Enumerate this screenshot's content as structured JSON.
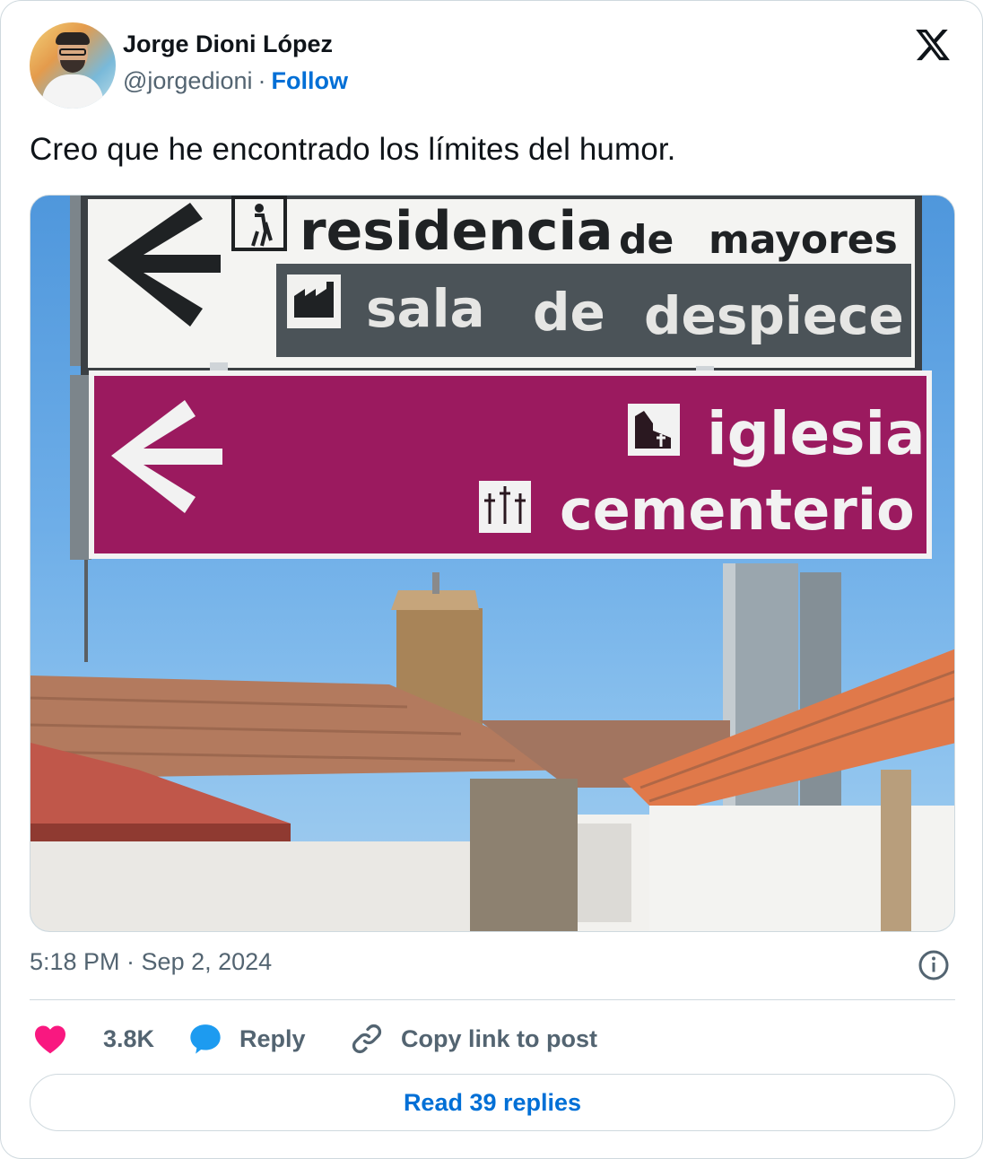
{
  "author": {
    "name": "Jorge Dioni López",
    "handle": "@jorgedioni",
    "separator": "·",
    "follow_label": "Follow"
  },
  "brand": {
    "logo_icon": "x-logo-icon"
  },
  "tweet": {
    "text": "Creo que he encontrado los límites del humor.",
    "timestamp": "5:18 PM · Sep 2, 2024"
  },
  "media": {
    "signs": [
      {
        "label": "residencia de mayores",
        "icon": "person-walking-cane-icon",
        "color": "#ffffff"
      },
      {
        "label": "sala de despiece",
        "icon": "factory-icon",
        "color": "#4b5358"
      },
      {
        "label": "iglesia",
        "icon": "church-icon",
        "color": "#9b1a5f"
      },
      {
        "label": "cementerio",
        "icon": "crosses-icon",
        "color": "#9b1a5f"
      }
    ],
    "words": {
      "residencia": "residencia",
      "de1": "de",
      "mayores": "mayores",
      "sala": "sala",
      "de2": "de",
      "despiece": "despiece",
      "iglesia": "iglesia",
      "cementerio": "cementerio"
    }
  },
  "actions": {
    "like_count": "3.8K",
    "reply_label": "Reply",
    "copy_label": "Copy link to post",
    "read_replies_label": "Read 39 replies"
  },
  "colors": {
    "like": "#f91880",
    "reply": "#1d9bf0",
    "link": "#006fd6",
    "muted": "#536471"
  }
}
